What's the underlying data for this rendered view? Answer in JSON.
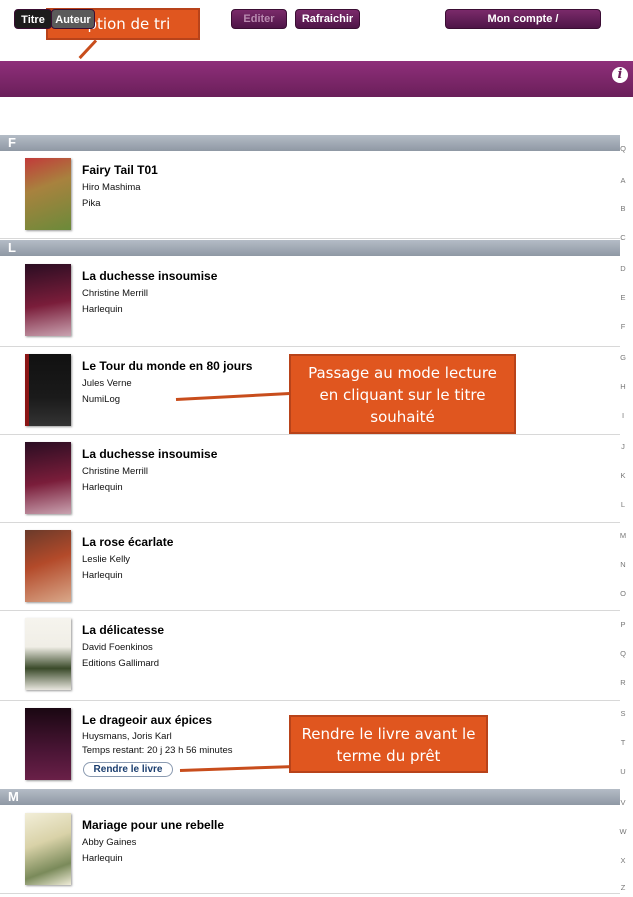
{
  "callouts": {
    "sort_option": "Option de tri",
    "reading_mode": "Passage au mode lecture en cliquant sur le titre souhaité",
    "return_book": "Rendre le livre avant le terme du prêt"
  },
  "toolbar": {
    "sort_title": "Titre",
    "sort_author": "Auteur",
    "edit": "Editer",
    "refresh": "Rafraichir",
    "account": "Mon compte / NumilogEbooks",
    "info": "i"
  },
  "sections": [
    "F",
    "L",
    "M"
  ],
  "books": [
    {
      "title": "Fairy Tail T01",
      "author": "Hiro Mashima",
      "publisher": "Pika",
      "cover_color": "#8a6a3a"
    },
    {
      "title": "La duchesse insoumise",
      "author": "Christine Merrill",
      "publisher": "Harlequin",
      "cover_color": "#5a1a3a"
    },
    {
      "title": "Le Tour du monde en 80 jours",
      "author": "Jules Verne",
      "publisher": "NumiLog",
      "cover_color": "#181818"
    },
    {
      "title": "La duchesse insoumise",
      "author": "Christine Merrill",
      "publisher": "Harlequin",
      "cover_color": "#5a1a3a"
    },
    {
      "title": "La rose écarlate",
      "author": "Leslie Kelly",
      "publisher": "Harlequin",
      "cover_color": "#7a2a1a"
    },
    {
      "title": "La délicatesse",
      "author": "David Foenkinos",
      "publisher": "Editions Gallimard",
      "cover_color": "#f2f0ea"
    },
    {
      "title": "Le drageoir aux épices",
      "author": "Huysmans, Joris Karl",
      "publisher": "Temps restant: 20 j  23 h  56 minutes",
      "cover_color": "#3a0f2a",
      "return_label": "Rendre le livre"
    },
    {
      "title": "Mariage pour une rebelle",
      "author": "Abby Gaines",
      "publisher": "Harlequin",
      "cover_color": "#e8e4d0"
    }
  ],
  "index": [
    "Q",
    "A",
    "B",
    "C",
    "D",
    "E",
    "F",
    "G",
    "H",
    "I",
    "J",
    "K",
    "L",
    "M",
    "N",
    "O",
    "P",
    "Q",
    "R",
    "S",
    "T",
    "U",
    "V",
    "W",
    "X",
    "Z"
  ]
}
